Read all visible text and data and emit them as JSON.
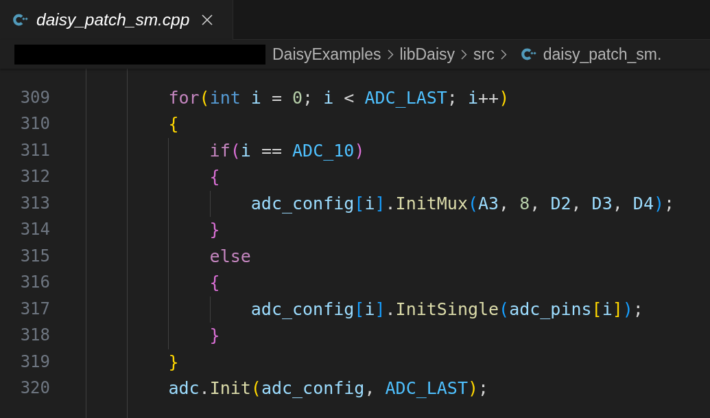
{
  "tab": {
    "title": "daisy_patch_sm.cpp",
    "selected": true,
    "preview": true
  },
  "breadcrumbs": [
    {
      "label": "DaisyExamples",
      "kind": "folder"
    },
    {
      "label": "libDaisy",
      "kind": "folder"
    },
    {
      "label": "src",
      "kind": "folder"
    },
    {
      "label": "daisy_patch_sm.",
      "kind": "file"
    }
  ],
  "lines": [
    {
      "number": "309",
      "tokens": [
        {
          "text": "        for",
          "kind": "keyword"
        },
        {
          "text": "(",
          "kind": "bracket1"
        },
        {
          "text": "int",
          "kind": "type"
        },
        {
          "text": " i",
          "kind": "variable"
        },
        {
          "text": " = ",
          "kind": "operator"
        },
        {
          "text": "0",
          "kind": "number"
        },
        {
          "text": "; ",
          "kind": "operator"
        },
        {
          "text": "i",
          "kind": "variable"
        },
        {
          "text": " < ",
          "kind": "operator"
        },
        {
          "text": "ADC_LAST",
          "kind": "constant"
        },
        {
          "text": "; ",
          "kind": "operator"
        },
        {
          "text": "i",
          "kind": "variable"
        },
        {
          "text": "++",
          "kind": "operator"
        },
        {
          "text": ")",
          "kind": "bracket1"
        }
      ]
    },
    {
      "number": "310",
      "tokens": [
        {
          "text": "        {",
          "kind": "bracket1"
        }
      ]
    },
    {
      "number": "311",
      "tokens": [
        {
          "text": "            if",
          "kind": "keyword"
        },
        {
          "text": "(",
          "kind": "bracket2"
        },
        {
          "text": "i",
          "kind": "variable"
        },
        {
          "text": " == ",
          "kind": "operator"
        },
        {
          "text": "ADC_10",
          "kind": "constant"
        },
        {
          "text": ")",
          "kind": "bracket2"
        }
      ]
    },
    {
      "number": "312",
      "tokens": [
        {
          "text": "            {",
          "kind": "bracket2"
        }
      ]
    },
    {
      "number": "313",
      "tokens": [
        {
          "text": "                adc_config",
          "kind": "variable"
        },
        {
          "text": "[",
          "kind": "bracket3"
        },
        {
          "text": "i",
          "kind": "variable"
        },
        {
          "text": "]",
          "kind": "bracket3"
        },
        {
          "text": ".",
          "kind": "operator"
        },
        {
          "text": "InitMux",
          "kind": "function"
        },
        {
          "text": "(",
          "kind": "bracket3"
        },
        {
          "text": "A3",
          "kind": "variable"
        },
        {
          "text": ", ",
          "kind": "operator"
        },
        {
          "text": "8",
          "kind": "number"
        },
        {
          "text": ", ",
          "kind": "operator"
        },
        {
          "text": "D2",
          "kind": "variable"
        },
        {
          "text": ", ",
          "kind": "operator"
        },
        {
          "text": "D3",
          "kind": "variable"
        },
        {
          "text": ", ",
          "kind": "operator"
        },
        {
          "text": "D4",
          "kind": "variable"
        },
        {
          "text": ")",
          "kind": "bracket3"
        },
        {
          "text": ";",
          "kind": "operator"
        }
      ]
    },
    {
      "number": "314",
      "tokens": [
        {
          "text": "            }",
          "kind": "bracket2"
        }
      ]
    },
    {
      "number": "315",
      "tokens": [
        {
          "text": "            else",
          "kind": "keyword"
        }
      ]
    },
    {
      "number": "316",
      "tokens": [
        {
          "text": "            {",
          "kind": "bracket2"
        }
      ]
    },
    {
      "number": "317",
      "tokens": [
        {
          "text": "                adc_config",
          "kind": "variable"
        },
        {
          "text": "[",
          "kind": "bracket3"
        },
        {
          "text": "i",
          "kind": "variable"
        },
        {
          "text": "]",
          "kind": "bracket3"
        },
        {
          "text": ".",
          "kind": "operator"
        },
        {
          "text": "InitSingle",
          "kind": "function"
        },
        {
          "text": "(",
          "kind": "bracket3"
        },
        {
          "text": "adc_pins",
          "kind": "variable"
        },
        {
          "text": "[",
          "kind": "bracket1"
        },
        {
          "text": "i",
          "kind": "variable"
        },
        {
          "text": "]",
          "kind": "bracket1"
        },
        {
          "text": ")",
          "kind": "bracket3"
        },
        {
          "text": ";",
          "kind": "operator"
        }
      ]
    },
    {
      "number": "318",
      "tokens": [
        {
          "text": "            }",
          "kind": "bracket2"
        }
      ]
    },
    {
      "number": "319",
      "tokens": [
        {
          "text": "        }",
          "kind": "bracket1"
        }
      ]
    },
    {
      "number": "320",
      "tokens": [
        {
          "text": "        adc",
          "kind": "variable"
        },
        {
          "text": ".",
          "kind": "operator"
        },
        {
          "text": "Init",
          "kind": "function"
        },
        {
          "text": "(",
          "kind": "bracket1"
        },
        {
          "text": "adc_config",
          "kind": "variable"
        },
        {
          "text": ", ",
          "kind": "operator"
        },
        {
          "text": "ADC_LAST",
          "kind": "constant"
        },
        {
          "text": ")",
          "kind": "bracket1"
        },
        {
          "text": ";",
          "kind": "operator"
        }
      ]
    }
  ]
}
